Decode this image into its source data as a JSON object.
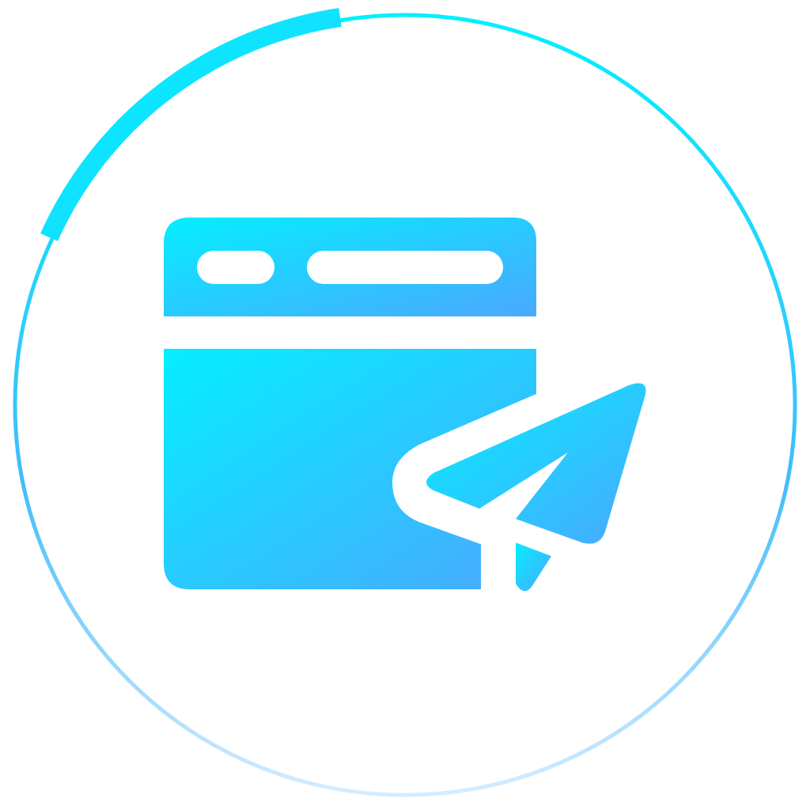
{
  "icon": {
    "name": "web-send-icon",
    "depicts": [
      "browser-window-icon",
      "paper-plane-icon"
    ]
  },
  "colors": {
    "ring_start": "#00F0FF",
    "ring_mid": "#42BDFB",
    "ring_end": "#D6ECFF",
    "fill_start": "#05EEFF",
    "fill_end": "#4AA8FF",
    "background": "#FFFFFF"
  }
}
